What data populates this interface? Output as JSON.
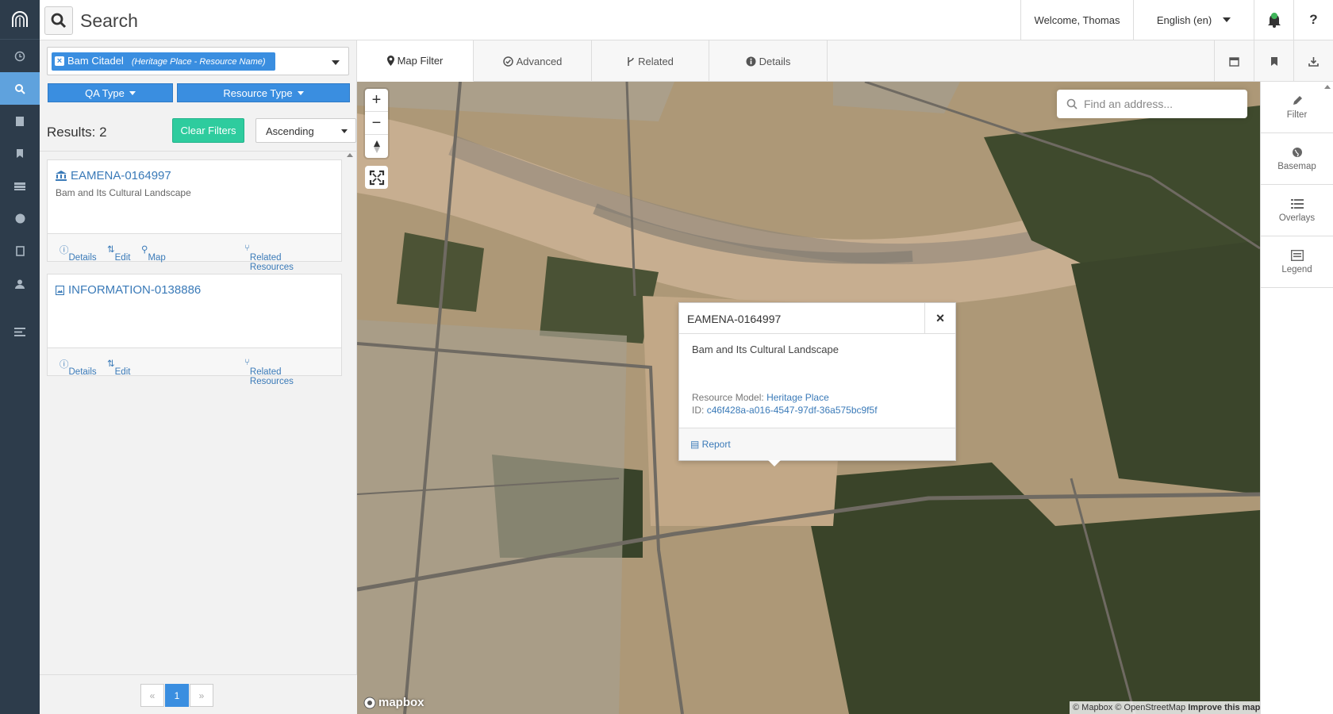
{
  "header": {
    "search_title": "Search",
    "welcome": "Welcome, Thomas",
    "language": "English (en)",
    "help": "?"
  },
  "rail": {
    "items": [
      "logo-icon",
      "clock-icon",
      "search-icon",
      "building-icon",
      "bookmark-icon",
      "list-icon",
      "globe-icon",
      "book-icon",
      "user-icon",
      "menu-icon"
    ]
  },
  "filter": {
    "term_label": "Bam Citadel",
    "term_context": "(Heritage Place - Resource Name)",
    "qa_type": "QA Type",
    "resource_type": "Resource Type",
    "results_label": "Results: 2",
    "clear_filters": "Clear Filters",
    "sort": "Ascending"
  },
  "results": [
    {
      "title": "EAMENA-0164997",
      "description": "Bam and Its Cultural Landscape",
      "actions": {
        "details": "Details",
        "edit": "Edit",
        "map": "Map",
        "related": "Related Resources"
      }
    },
    {
      "title": "INFORMATION-0138886",
      "description": "",
      "actions": {
        "details": "Details",
        "edit": "Edit",
        "related": "Related Resources"
      }
    }
  ],
  "pager": {
    "prev": "«",
    "current": "1",
    "next": "»"
  },
  "tabs": [
    {
      "label": "Map Filter",
      "icon": "map-marker-icon",
      "active": true
    },
    {
      "label": "Advanced",
      "icon": "check-circle-icon",
      "active": false
    },
    {
      "label": "Related",
      "icon": "branch-icon",
      "active": false
    },
    {
      "label": "Details",
      "icon": "info-icon",
      "active": false
    }
  ],
  "map": {
    "geocoder_placeholder": "Find an address...",
    "zoom_in": "+",
    "zoom_out": "−",
    "popup": {
      "title": "EAMENA-0164997",
      "close": "×",
      "description": "Bam and Its Cultural Landscape",
      "model_label": "Resource Model:",
      "model_value": "Heritage Place",
      "id_label": "ID:",
      "id_value": "c46f428a-a016-4547-97df-36a575bc9f5f",
      "report": "Report"
    },
    "mapbox_logo": "mapbox",
    "attribution_1": "© Mapbox © OpenStreetMap ",
    "attribution_2": "Improve this map"
  },
  "map_tools": [
    {
      "label": "Filter",
      "icon": "pencil-icon"
    },
    {
      "label": "Basemap",
      "icon": "globe-icon"
    },
    {
      "label": "Overlays",
      "icon": "list-icon"
    },
    {
      "label": "Legend",
      "icon": "legend-icon"
    }
  ],
  "colors": {
    "accent": "#3a8ee0",
    "clear": "#2ecc9e",
    "rail": "#2d3c4b",
    "link": "#3a7ab8"
  }
}
